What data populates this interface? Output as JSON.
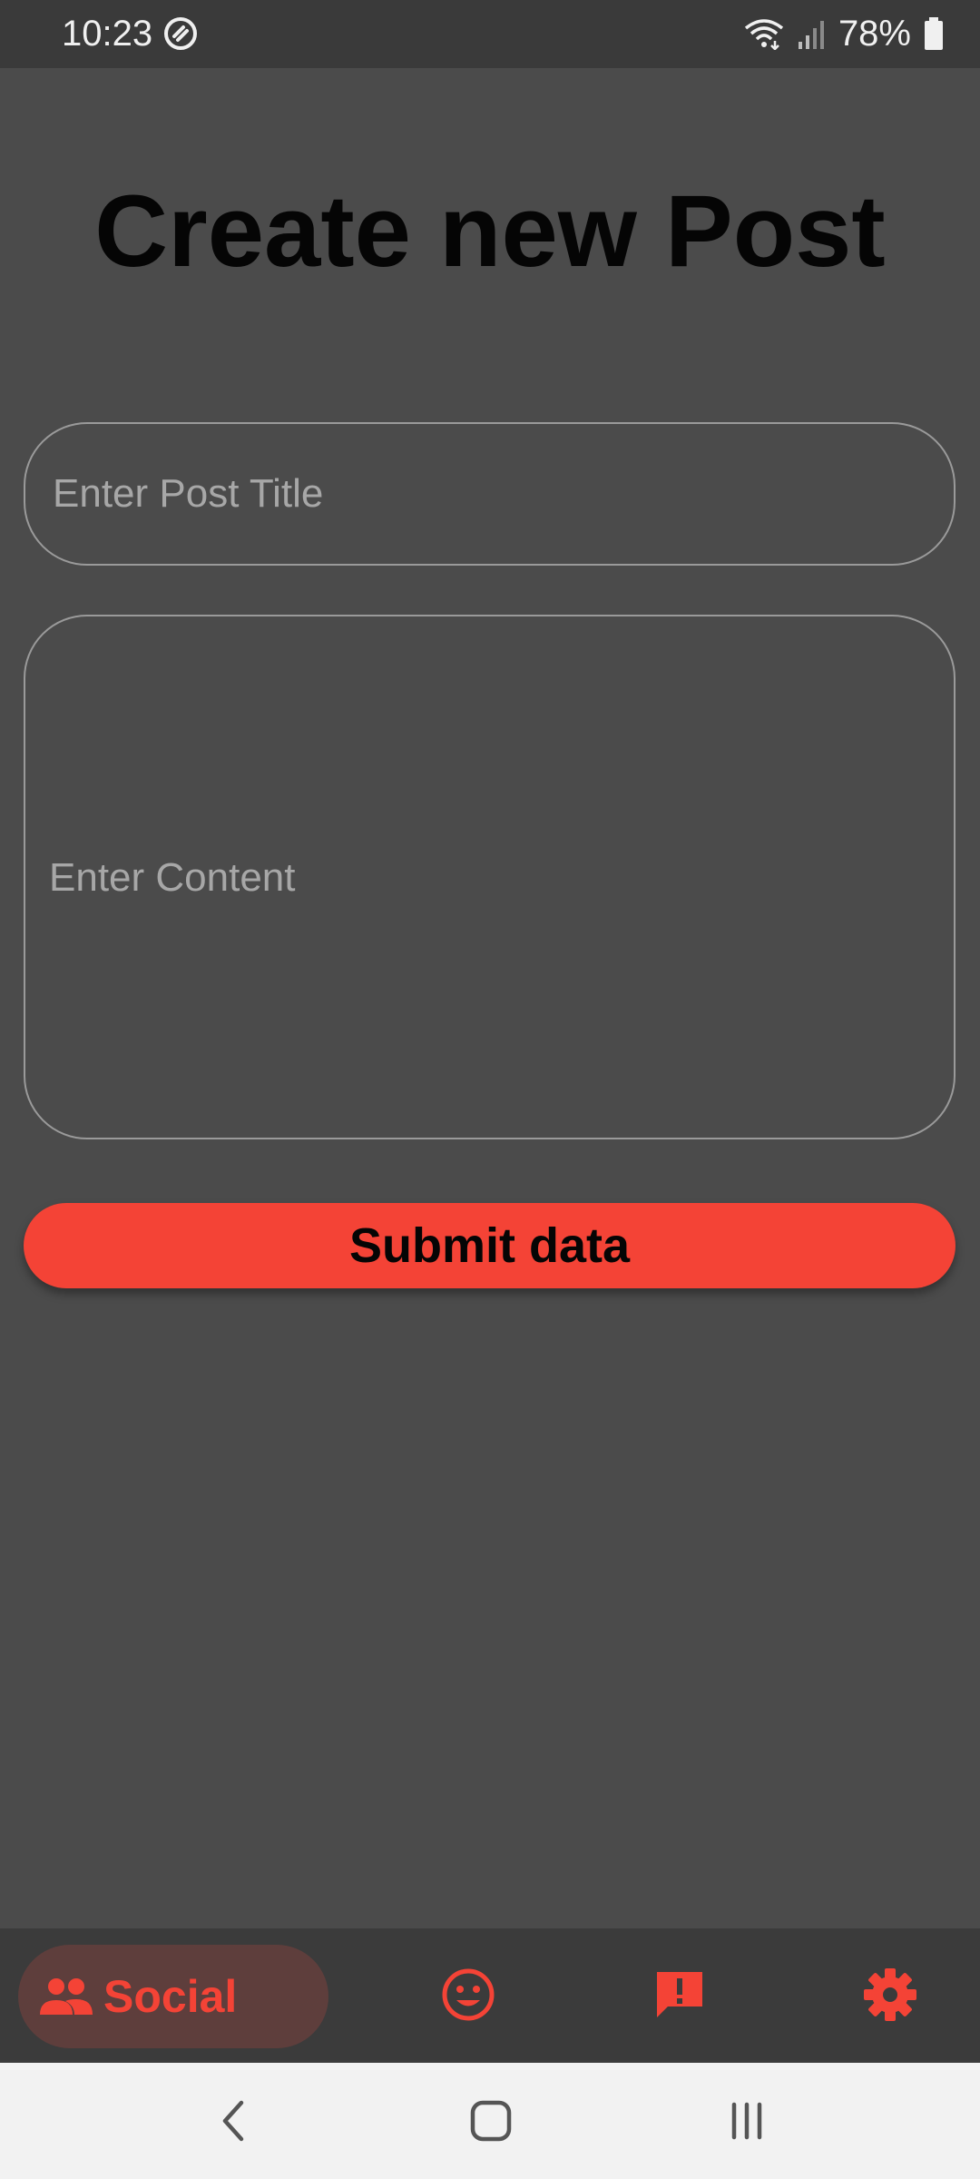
{
  "status_bar": {
    "time": "10:23",
    "battery": "78%"
  },
  "page": {
    "title": "Create new Post"
  },
  "form": {
    "title_placeholder": "Enter Post Title",
    "content_placeholder": "Enter Content",
    "submit_label": "Submit data"
  },
  "bottom_nav": {
    "items": [
      {
        "label": "Social",
        "icon": "people-icon",
        "active": true
      },
      {
        "label": "",
        "icon": "emoji-icon"
      },
      {
        "label": "",
        "icon": "feedback-icon"
      },
      {
        "label": "",
        "icon": "gear-icon"
      }
    ]
  },
  "colors": {
    "accent": "#f44336",
    "background": "#4b4b4b",
    "nav_background": "#3b3b3b",
    "active_pill": "#5e3e3c"
  }
}
